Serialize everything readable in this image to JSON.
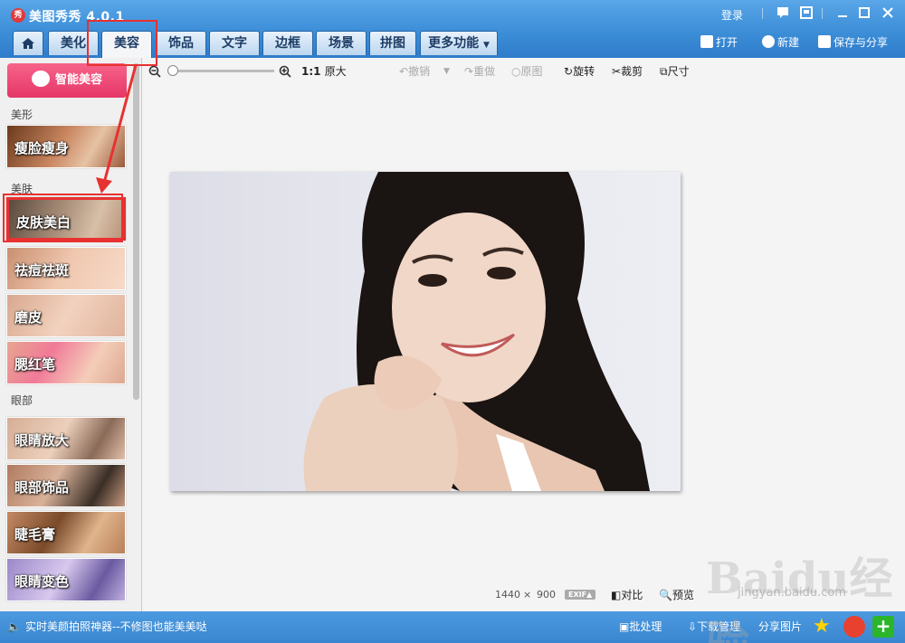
{
  "title_bar": {
    "logo_text": "秀",
    "app_title": "美图秀秀 4.0.1",
    "login": "登录"
  },
  "tabs": [
    {
      "label": "",
      "icon": "home-icon"
    },
    {
      "label": "美化"
    },
    {
      "label": "美容",
      "active": true
    },
    {
      "label": "饰品"
    },
    {
      "label": "文字"
    },
    {
      "label": "边框"
    },
    {
      "label": "场景"
    },
    {
      "label": "拼图"
    },
    {
      "label": "更多功能"
    }
  ],
  "header_actions": {
    "open": "打开",
    "new": "新建",
    "save_share": "保存与分享"
  },
  "left_panel": {
    "smart_button": "智能美容",
    "sections": {
      "shape": "美形",
      "skin": "美肤",
      "eye": "眼部"
    },
    "items": [
      {
        "label": "瘦脸瘦身"
      },
      {
        "label": "皮肤美白",
        "selected": true
      },
      {
        "label": "祛痘祛斑"
      },
      {
        "label": "磨皮"
      },
      {
        "label": "腮红笔"
      },
      {
        "label": "眼睛放大"
      },
      {
        "label": "眼部饰品"
      },
      {
        "label": "睫毛膏"
      },
      {
        "label": "眼睛变色"
      }
    ]
  },
  "toolbar": {
    "zoom_ratio": "1:1",
    "original_size": "原大",
    "undo": "撤销",
    "redo": "重做",
    "original": "原图",
    "rotate": "旋转",
    "crop": "裁剪",
    "size": "尺寸"
  },
  "image_info": {
    "width": "1440",
    "times": "×",
    "height": "900",
    "exif": "EXIF",
    "compare": "对比",
    "preview": "预览"
  },
  "status_bar": {
    "tip": "实时美颜拍照神器--不修图也能美美哒",
    "batch": "批处理",
    "download": "下载管理",
    "share": "分享图片"
  },
  "watermark": {
    "text": "Baidu经验",
    "url": "jingyan.baidu.com"
  },
  "colors": {
    "accent_blue": "#3d8fd8",
    "highlight_red": "#e83131",
    "smart_pink": "#e53668"
  }
}
